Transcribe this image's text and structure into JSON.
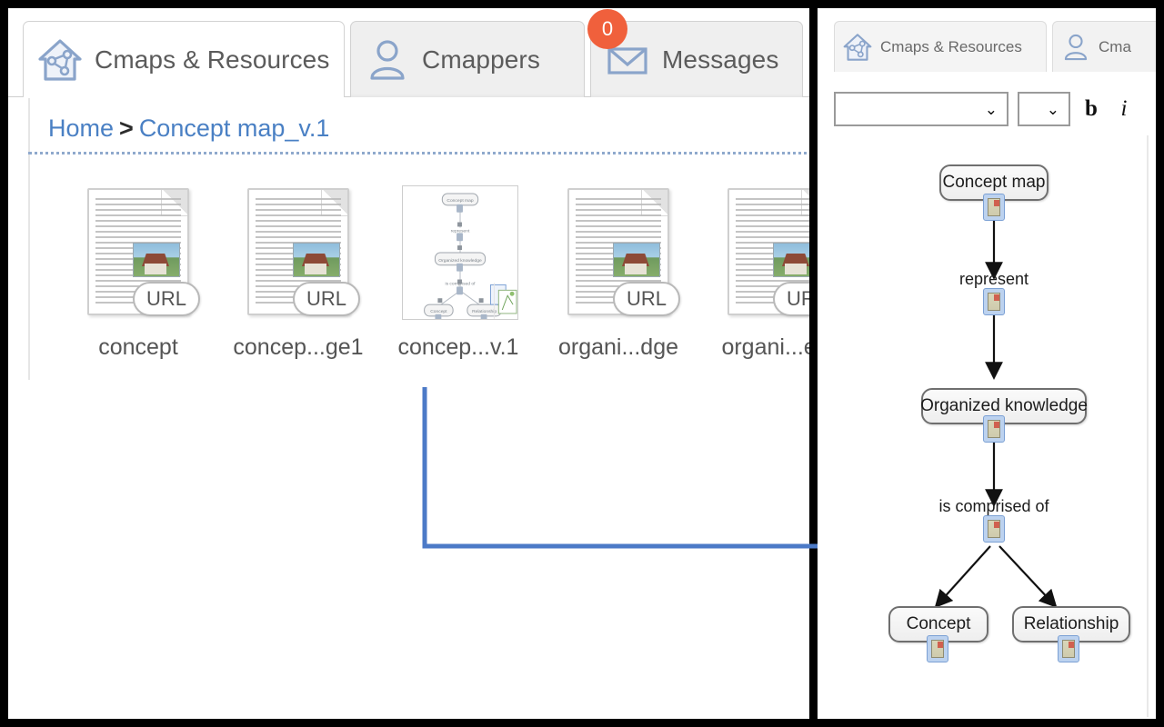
{
  "left_panel": {
    "tabs": [
      {
        "id": "cmaps",
        "label": "Cmaps & Resources",
        "icon": "house-cmap-icon",
        "active": true
      },
      {
        "id": "cmappers",
        "label": "Cmappers",
        "icon": "person-icon",
        "active": false
      },
      {
        "id": "messages",
        "label": "Messages",
        "icon": "envelope-icon",
        "active": false,
        "badge": "0"
      }
    ],
    "breadcrumb": {
      "root": "Home",
      "separator": ">",
      "current": "Concept map_v.1"
    },
    "resources": [
      {
        "name": "concept",
        "type": "url-document",
        "badge": "URL"
      },
      {
        "name": "concep...ge1",
        "type": "url-document",
        "badge": "URL"
      },
      {
        "name": "concep...v.1",
        "type": "concept-map",
        "badge": "",
        "selected": true
      },
      {
        "name": "organi...dge",
        "type": "url-document",
        "badge": "URL"
      },
      {
        "name": "organi...ept",
        "type": "url-document",
        "badge": "URL"
      }
    ]
  },
  "right_panel": {
    "tabs": [
      {
        "id": "cmaps",
        "label": "Cmaps & Resources",
        "icon": "house-cmap-icon",
        "active": true
      },
      {
        "id": "cmappers",
        "label": "Cma",
        "icon": "person-icon",
        "active": false
      }
    ],
    "toolbar": {
      "font_value": "",
      "font_placeholder": "",
      "size_value": "",
      "bold_label": "b",
      "italic_label": "i"
    },
    "concept_map": {
      "nodes": [
        {
          "id": "n1",
          "label": "Concept map"
        },
        {
          "id": "n2",
          "label": "Organized   knowledge"
        },
        {
          "id": "n3",
          "label": "Concept"
        },
        {
          "id": "n4",
          "label": "Relationship"
        }
      ],
      "links": [
        {
          "id": "l1",
          "label": "represent",
          "from": "n1",
          "to": "n2"
        },
        {
          "id": "l2",
          "label": "is comprised of",
          "from": "n2",
          "to": "n3"
        },
        {
          "id": "l3",
          "label": "is comprised of",
          "from": "n2",
          "to": "n4"
        }
      ]
    }
  },
  "annotation": {
    "pointer_color": "#4c7ac7",
    "description": "callout arrow from selected concept map thumbnail to the opened map"
  },
  "colors": {
    "accent_blue": "#4a80c4",
    "badge_red": "#f0603c",
    "frame_black": "#000000",
    "tab_grey": "#efefef",
    "text_grey": "#5b5b5b"
  }
}
